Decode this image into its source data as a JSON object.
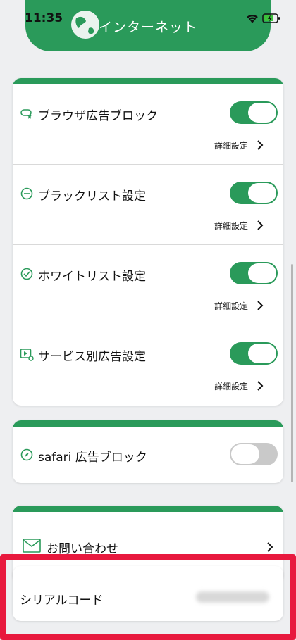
{
  "status": {
    "time": "11:35"
  },
  "header": {
    "title": "インターネット"
  },
  "colors": {
    "accent": "#2a9a5a",
    "highlight": "#e8193e"
  },
  "main_card": {
    "rows": [
      {
        "label": "ブラウザ広告ブロック",
        "icon": "ad-block-icon",
        "toggle_on": true,
        "detail_label": "詳細設定"
      },
      {
        "label": "ブラックリスト設定",
        "icon": "minus-circle-icon",
        "toggle_on": true,
        "detail_label": "詳細設定"
      },
      {
        "label": "ホワイトリスト設定",
        "icon": "check-circle-icon",
        "toggle_on": true,
        "detail_label": "詳細設定"
      },
      {
        "label": "サービス別広告設定",
        "icon": "video-settings-icon",
        "toggle_on": true,
        "detail_label": "詳細設定"
      }
    ]
  },
  "safari_card": {
    "label": "safari 広告ブロック",
    "icon": "compass-icon",
    "toggle_on": false
  },
  "contact_card": {
    "label": "お問い合わせ",
    "icon": "mail-icon"
  },
  "serial_card": {
    "label": "シリアルコード"
  }
}
